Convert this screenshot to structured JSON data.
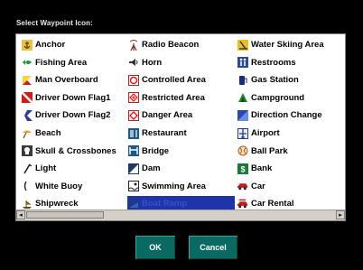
{
  "dialog": {
    "title": "Select Waypoint Icon:",
    "ok_label": "OK",
    "cancel_label": "Cancel"
  },
  "icons": {
    "columns": [
      [
        {
          "label": "Anchor",
          "icon": "anchor-icon"
        },
        {
          "label": "Fishing Area",
          "icon": "fish-icon"
        },
        {
          "label": "Man Overboard",
          "icon": "flag-red-icon"
        },
        {
          "label": "Driver Down Flag1",
          "icon": "diver-flag-icon"
        },
        {
          "label": "Driver Down Flag2",
          "icon": "diver-flag2-icon"
        },
        {
          "label": "Beach",
          "icon": "beach-icon"
        },
        {
          "label": "Skull & Crossbones",
          "icon": "skull-icon"
        },
        {
          "label": "Light",
          "icon": "light-icon"
        },
        {
          "label": "White Buoy",
          "icon": "buoy-icon"
        },
        {
          "label": "Shipwreck",
          "icon": "shipwreck-icon"
        }
      ],
      [
        {
          "label": "Radio Beacon",
          "icon": "radio-beacon-icon"
        },
        {
          "label": "Horn",
          "icon": "horn-icon"
        },
        {
          "label": "Controlled Area",
          "icon": "controlled-area-icon"
        },
        {
          "label": "Restricted Area",
          "icon": "restricted-area-icon"
        },
        {
          "label": "Danger Area",
          "icon": "danger-area-icon"
        },
        {
          "label": "Restaurant",
          "icon": "restaurant-icon"
        },
        {
          "label": "Bridge",
          "icon": "bridge-icon"
        },
        {
          "label": "Dam",
          "icon": "dam-icon"
        },
        {
          "label": "Swimming Area",
          "icon": "swimming-icon"
        },
        {
          "label": "Boat Ramp",
          "icon": "boat-ramp-icon",
          "selected": true
        }
      ],
      [
        {
          "label": "Water Skiing Area",
          "icon": "water-ski-icon"
        },
        {
          "label": "Restrooms",
          "icon": "restrooms-icon"
        },
        {
          "label": "Gas Station",
          "icon": "gas-station-icon"
        },
        {
          "label": "Campground",
          "icon": "campground-icon"
        },
        {
          "label": "Direction Change",
          "icon": "direction-change-icon"
        },
        {
          "label": "Airport",
          "icon": "airport-icon"
        },
        {
          "label": "Ball Park",
          "icon": "ball-park-icon"
        },
        {
          "label": "Bank",
          "icon": "bank-icon"
        },
        {
          "label": "Car",
          "icon": "car-icon"
        },
        {
          "label": "Car Rental",
          "icon": "car-rental-icon"
        }
      ]
    ]
  },
  "colors": {
    "selected_bg": "#1f34a8",
    "button_bg": "#0a6a62"
  }
}
